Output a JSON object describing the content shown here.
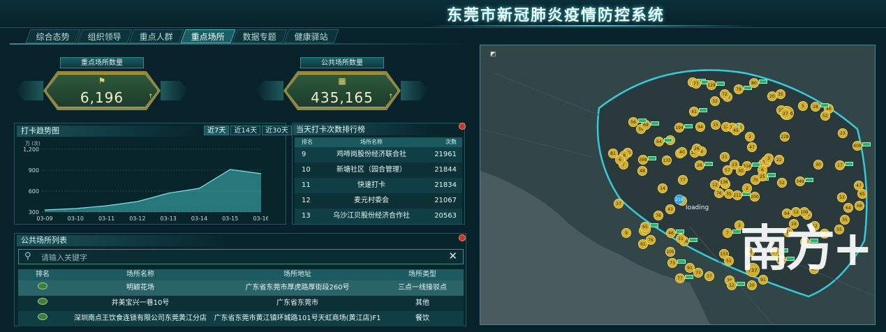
{
  "header": {
    "title": "东莞市新冠肺炎疫情防控系统"
  },
  "tabs": [
    {
      "label": "综合态势"
    },
    {
      "label": "组织领导"
    },
    {
      "label": "重点人群"
    },
    {
      "label": "重点场所",
      "active": true
    },
    {
      "label": "数据专题"
    },
    {
      "label": "健康驿站"
    }
  ],
  "stats": {
    "key_places": {
      "label": "重点场所数量",
      "value": "6,196",
      "arrow": "↑"
    },
    "public_places": {
      "label": "公共场所数量",
      "value": "435,165",
      "arrow": "↑"
    }
  },
  "trend": {
    "title": "打卡趋势图",
    "ranges": [
      "近7天",
      "近14天",
      "近30天"
    ],
    "unit": "万 (次)"
  },
  "chart_data": {
    "type": "area",
    "x": [
      "03-09",
      "03-10",
      "03-11",
      "03-12",
      "03-13",
      "03-14",
      "03-15",
      "03-16"
    ],
    "values": [
      330,
      350,
      390,
      450,
      570,
      640,
      910,
      850
    ],
    "ylim": [
      300,
      1200
    ],
    "yticks": [
      "1,200",
      "900",
      "600",
      "300"
    ]
  },
  "ranking": {
    "title": "当天打卡次数排行榜",
    "headers": [
      "排名",
      "场所名称",
      "次数"
    ],
    "rows": [
      [
        "9",
        "鸡啼岗股份经济联合社",
        "21961"
      ],
      [
        "10",
        "新塘社区（园合管理）",
        "21844"
      ],
      [
        "11",
        "快速打卡",
        "21834"
      ],
      [
        "12",
        "麦元村委会",
        "21067"
      ],
      [
        "13",
        "乌沙江贝股份经济合作社",
        "20563"
      ]
    ]
  },
  "public_list": {
    "title": "公共场所列表",
    "search_placeholder": "请输入关键字",
    "headers": [
      "排名",
      "场所名称",
      "场所地址",
      "场所类型"
    ],
    "rows": [
      [
        "明颖花场",
        "广东省东莞市厚虎路厚街段260号",
        "三点一线接驳点"
      ],
      [
        "井美宝兴一巷10号",
        "广东省东莞市",
        "其他"
      ],
      [
        "深圳南点王饮食连锁有限公司东莞黄江分店",
        "广东省东莞市黄江镇环城路101号天虹商场(黄江店)F1",
        "餐饮"
      ]
    ]
  },
  "map": {
    "loading_text": "loading",
    "watermark": "南方+",
    "blue_marker": "219",
    "markers": [
      "211",
      "39",
      "30",
      "76",
      "108",
      "35",
      "32",
      "1046",
      "70",
      "48",
      "76",
      "228",
      "12",
      "47",
      "76",
      "8",
      "73",
      "74",
      "61",
      "26",
      "69",
      "50",
      "7",
      "94",
      "409",
      "136",
      "153",
      "57",
      "194",
      "5",
      "31",
      "109",
      "80",
      "147",
      "133",
      "41",
      "77",
      "81",
      "6",
      "51",
      "25",
      "61",
      "23",
      "19",
      "141",
      "105",
      "40",
      "46",
      "79",
      "77",
      "60",
      "6",
      "28",
      "20",
      "32",
      "23",
      "7",
      "73",
      "12",
      "59",
      "64",
      "37",
      "21",
      "737",
      "318",
      "52",
      "35",
      "36",
      "17",
      "2",
      "40",
      "20",
      "64",
      "72",
      "65",
      "22",
      "78",
      "30",
      "55",
      "8",
      "12",
      "55",
      "27",
      "14",
      "6",
      "47",
      "6",
      "76",
      "46",
      "91",
      "65",
      "52",
      "26",
      "53",
      "45",
      "12",
      "77",
      "9",
      "35",
      "15",
      "129",
      "55",
      "2",
      "94",
      "349",
      "43",
      "37",
      "30",
      "56",
      "31",
      "91",
      "40",
      "41",
      "64",
      "12",
      "57",
      "65",
      "68",
      "26",
      "200",
      "399",
      "13",
      "2",
      "3"
    ]
  },
  "colors": {
    "accent": "#3fc7d2",
    "gold": "#d7b12c",
    "bg": "#07222a"
  }
}
